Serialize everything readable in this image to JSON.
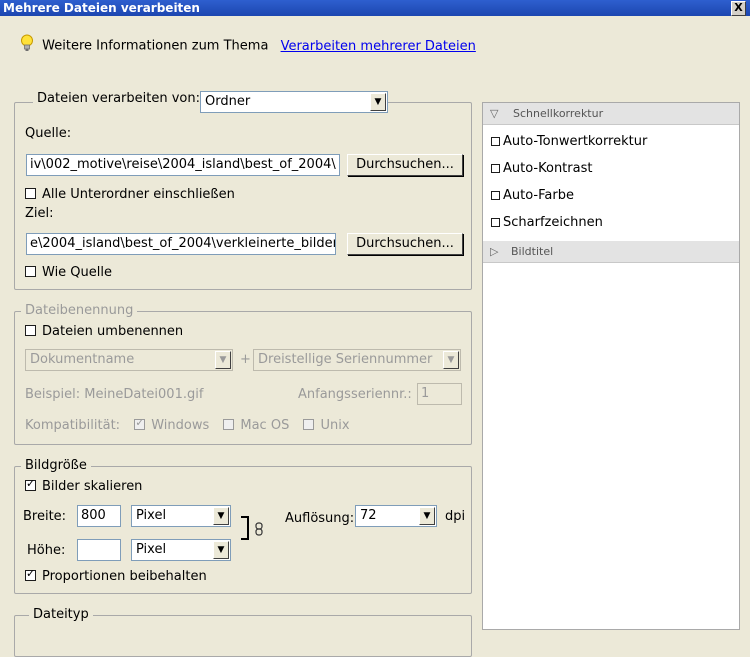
{
  "window": {
    "title": "Mehrere Dateien verarbeiten",
    "close": "X"
  },
  "info": {
    "text": "Weitere Informationen zum Thema",
    "link": "Verarbeiten mehrerer Dateien"
  },
  "source": {
    "process_from_label": "Dateien verarbeiten von:",
    "process_from_value": "Ordner",
    "source_label": "Quelle:",
    "source_path": "iv\\002_motive\\reise\\2004_island\\best_of_2004\\",
    "browse": "Durchsuchen...",
    "include_subfolders": "Alle Unterordner einschließen",
    "target_label": "Ziel:",
    "target_path": "e\\2004_island\\best_of_2004\\verkleinerte_bilder",
    "same_as_source": "Wie Quelle"
  },
  "naming": {
    "legend": "Dateibenennung",
    "rename": "Dateien umbenennen",
    "name_select": "Dokumentname",
    "plus": "+",
    "serial_select": "Dreistellige Seriennummer",
    "example": "Beispiel: MeineDatei001.gif",
    "start_serial_label": "Anfangsseriennr.:",
    "start_serial_value": "1",
    "compat_label": "Kompatibilität:",
    "windows": "Windows",
    "macos": "Mac OS",
    "unix": "Unix"
  },
  "size": {
    "legend": "Bildgröße",
    "scale": "Bilder skalieren",
    "width_label": "Breite:",
    "width_value": "800",
    "width_unit": "Pixel",
    "height_label": "Höhe:",
    "height_value": "",
    "height_unit": "Pixel",
    "resolution_label": "Auflösung:",
    "resolution_value": "72",
    "resolution_unit": "dpi",
    "proportions": "Proportionen beibehalten"
  },
  "filetype": {
    "legend": "Dateityp"
  },
  "quickfix": {
    "header": "Schnellkorrektur",
    "items": [
      "Auto-Tonwertkorrektur",
      "Auto-Kontrast",
      "Auto-Farbe",
      "Scharfzeichnen"
    ]
  },
  "caption": {
    "header": "Bildtitel"
  },
  "colors": {
    "title_bar": "#1C46B0",
    "dialog_bg": "#ECE9D8",
    "link": "#0000EE"
  }
}
